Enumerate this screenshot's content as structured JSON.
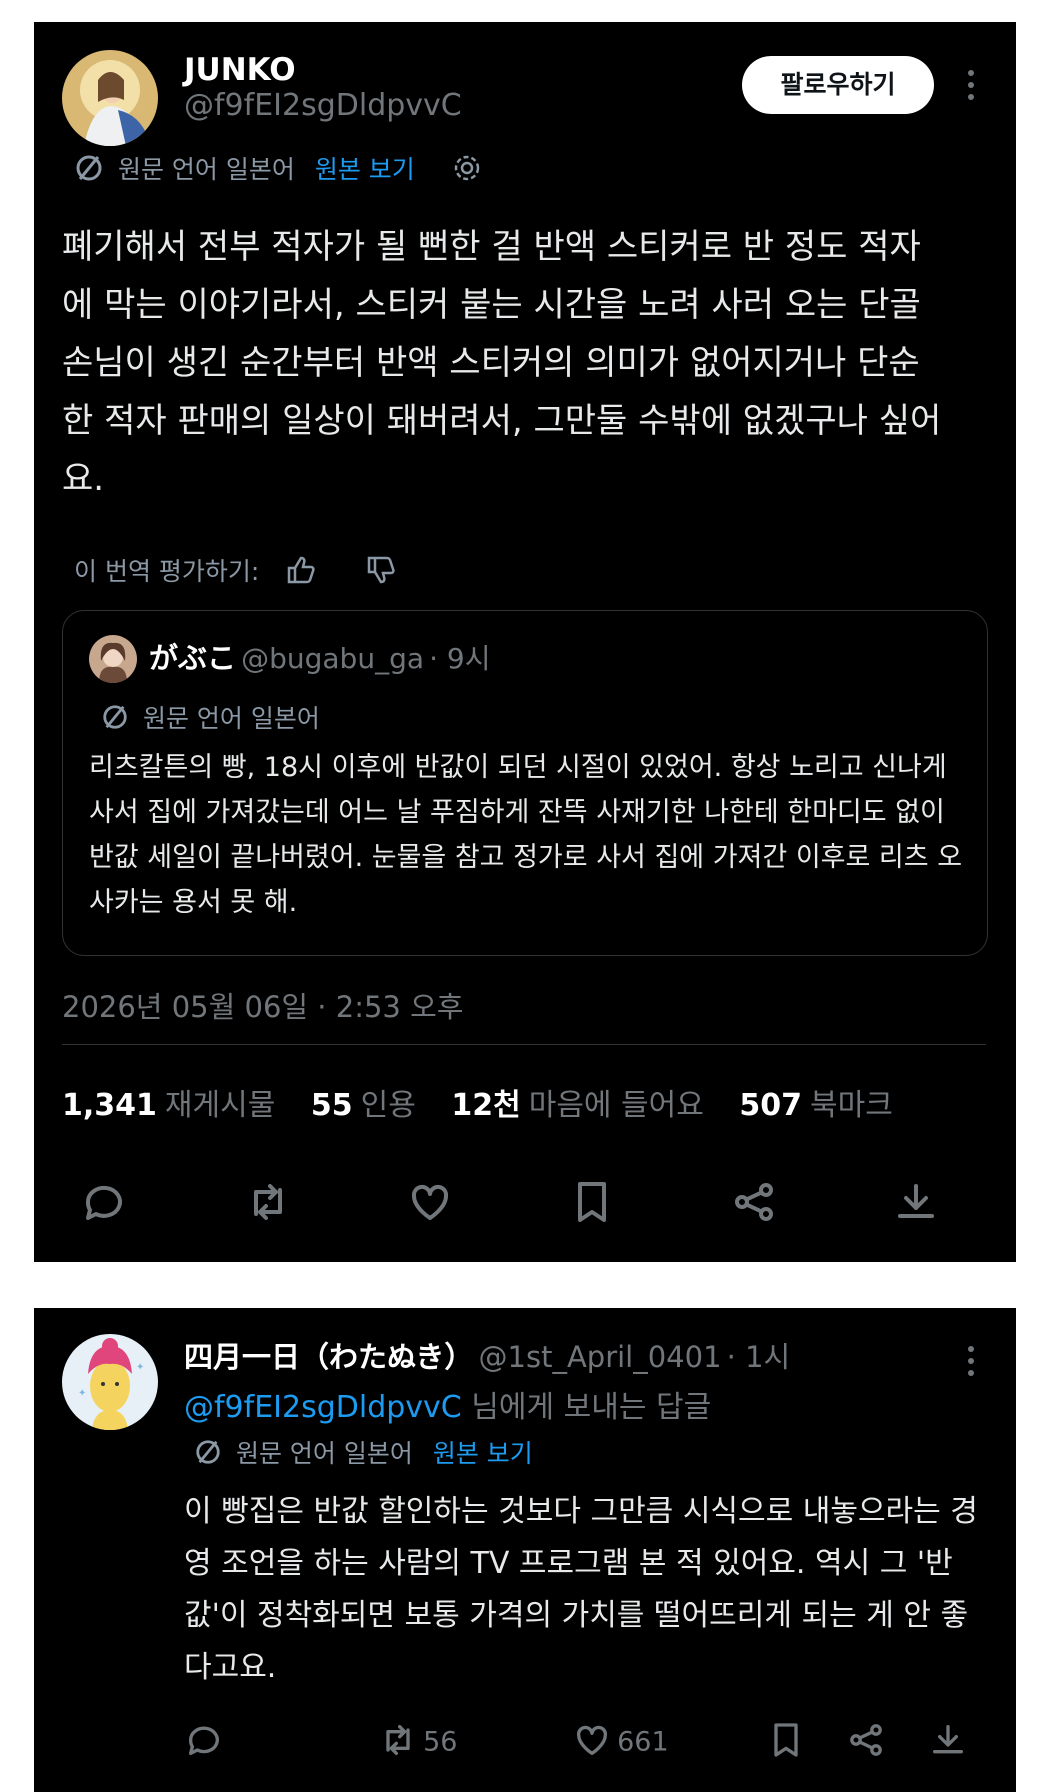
{
  "tweet": {
    "author_name": "JUNKO",
    "author_handle": "@f9fEI2sgDldpvvC",
    "follow_label": "팔로우하기",
    "translation_note": "원문 언어 일본어",
    "view_original": "원본 보기",
    "text": "폐기해서 전부 적자가 될 뻔한 걸 반액 스티커로 반 정도 적자에 막는 이야기라서, 스티커 붙는 시간을 노려 사러 오는 단골 손님이 생긴 순간부터 반액 스티커의 의미가 없어지거나 단순한 적자 판매의 일상이 돼버려서, 그만둘 수밖에 없겠구나 싶어요.",
    "rate_label": "이 번역 평가하기:",
    "quote": {
      "author_name": "がぶこ",
      "author_handle": "@bugabu_ga",
      "time": "· 9시",
      "translation_note": "원문 언어 일본어",
      "text": "리츠칼튼의 빵, 18시 이후에 반값이 되던 시절이 있었어. 항상 노리고 신나게 사서 집에 가져갔는데 어느 날 푸짐하게 잔뜩 사재기한 나한테 한마디도 없이 반값 세일이 끝나버렸어. 눈물을 참고 정가로 사서 집에 가져간 이후로 리츠 오사카는 용서 못 해."
    },
    "timestamp": "2026년 05월 06일 · 2:53 오후",
    "stats": [
      {
        "count": "1,341",
        "label": "재게시물"
      },
      {
        "count": "55",
        "label": "인용"
      },
      {
        "count": "12천",
        "label": "마음에 들어요"
      },
      {
        "count": "507",
        "label": "북마크"
      }
    ]
  },
  "reply": {
    "author_name": "四月一日（わたぬき）",
    "author_handle": "@1st_April_0401",
    "time": "· 1시",
    "reply_to_handle": "@f9fEI2sgDldpvvC",
    "reply_to_suffix": "님에게 보내는 답글",
    "translation_note": "원문 언어 일본어",
    "view_original": "원본 보기",
    "text": "이 빵집은 반값 할인하는 것보다 그만큼 시식으로 내놓으라는 경영 조언을 하는 사람의 TV 프로그램 본 적 있어요. 역시 그 '반값'이 정착화되면 보통 가격의 가치를 떨어뜨리게 되는 게 안 좋다고요.",
    "retweet_count": "56",
    "like_count": "661"
  },
  "colors": {
    "background": "#000000",
    "text": "#e7e9ea",
    "secondary": "#71767b",
    "link": "#1d9bf0"
  }
}
